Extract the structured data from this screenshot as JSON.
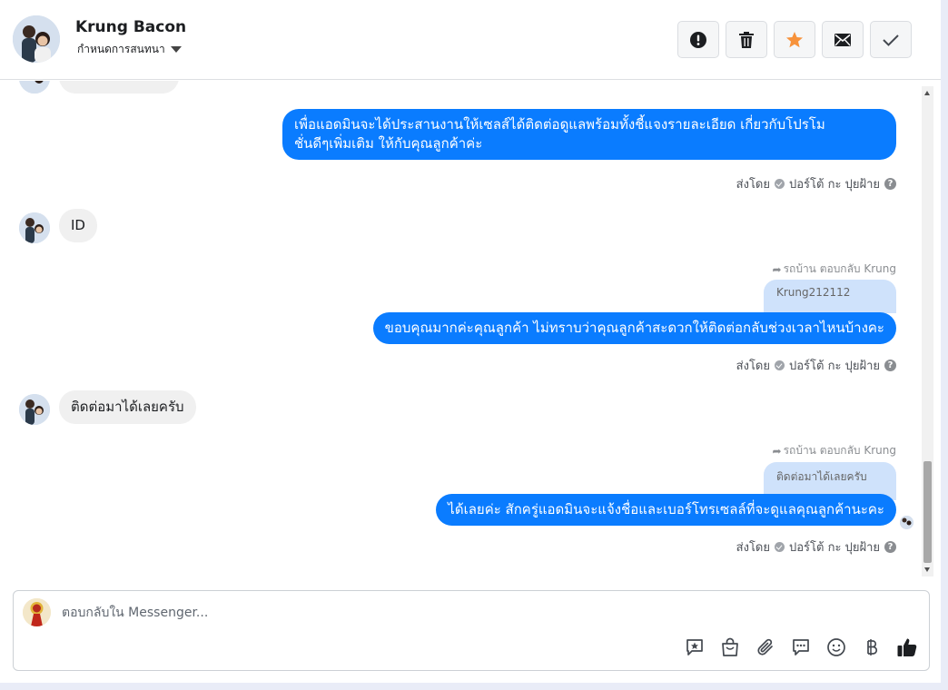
{
  "contact": {
    "name": "Krung Bacon",
    "assign_label": "กำหนดการสนทนา"
  },
  "header_actions": [
    {
      "name": "spam",
      "icon": "alert-circle-icon"
    },
    {
      "name": "delete",
      "icon": "trash-icon"
    },
    {
      "name": "star",
      "icon": "star-icon",
      "color": "#f7923b"
    },
    {
      "name": "mark-unread",
      "icon": "envelope-icon"
    },
    {
      "name": "done",
      "icon": "check-icon"
    }
  ],
  "messages": {
    "msg1": {
      "line1": "เพื่อแอดมินจะได้ประสานงานให้เซลส์ได้ติดต่อดูแลพร้อมทั้งชี้แจงรายละเอียด เกี่ยวกับโปรโม",
      "line2": "ชั่นดีๆเพิ่มเติม ให้กับคุณลูกค้าค่ะ"
    },
    "in1": "ID",
    "msg2": {
      "reply_note": "รถบ้าน ตอบกลับ Krung",
      "quote": "Krung212112",
      "text": "ขอบคุณมากค่ะคุณลูกค้า ไม่ทราบว่าคุณลูกค้าสะดวกให้ติดต่อกลับช่วงเวลาไหนบ้างคะ"
    },
    "in2": "ติดต่อมาได้เลยครับ",
    "msg3": {
      "reply_note": "รถบ้าน ตอบกลับ Krung",
      "quote": "ติดต่อมาได้เลยครับ",
      "text": "ได้เลยค่ะ สักครู่แอดมินจะแจ้งชื่อและเบอร์โทรเซลล์ที่จะดูแลคุณลูกค้านะคะ"
    }
  },
  "sent_by": {
    "prefix": "ส่งโดย",
    "agent": "ปอร์โต้ กะ ปุยฝ้าย"
  },
  "composer": {
    "placeholder": "ตอบกลับใน Messenger..."
  },
  "composer_tools": [
    "saved-reply-icon",
    "shop-bag-icon",
    "paperclip-icon",
    "chat-bubble-icon",
    "smiley-icon",
    "baht-icon",
    "thumbs-up-icon"
  ],
  "colors": {
    "accent": "#0a7cff",
    "quote_bg": "#cfe2fb",
    "incoming_bg": "#f0f0f0"
  }
}
